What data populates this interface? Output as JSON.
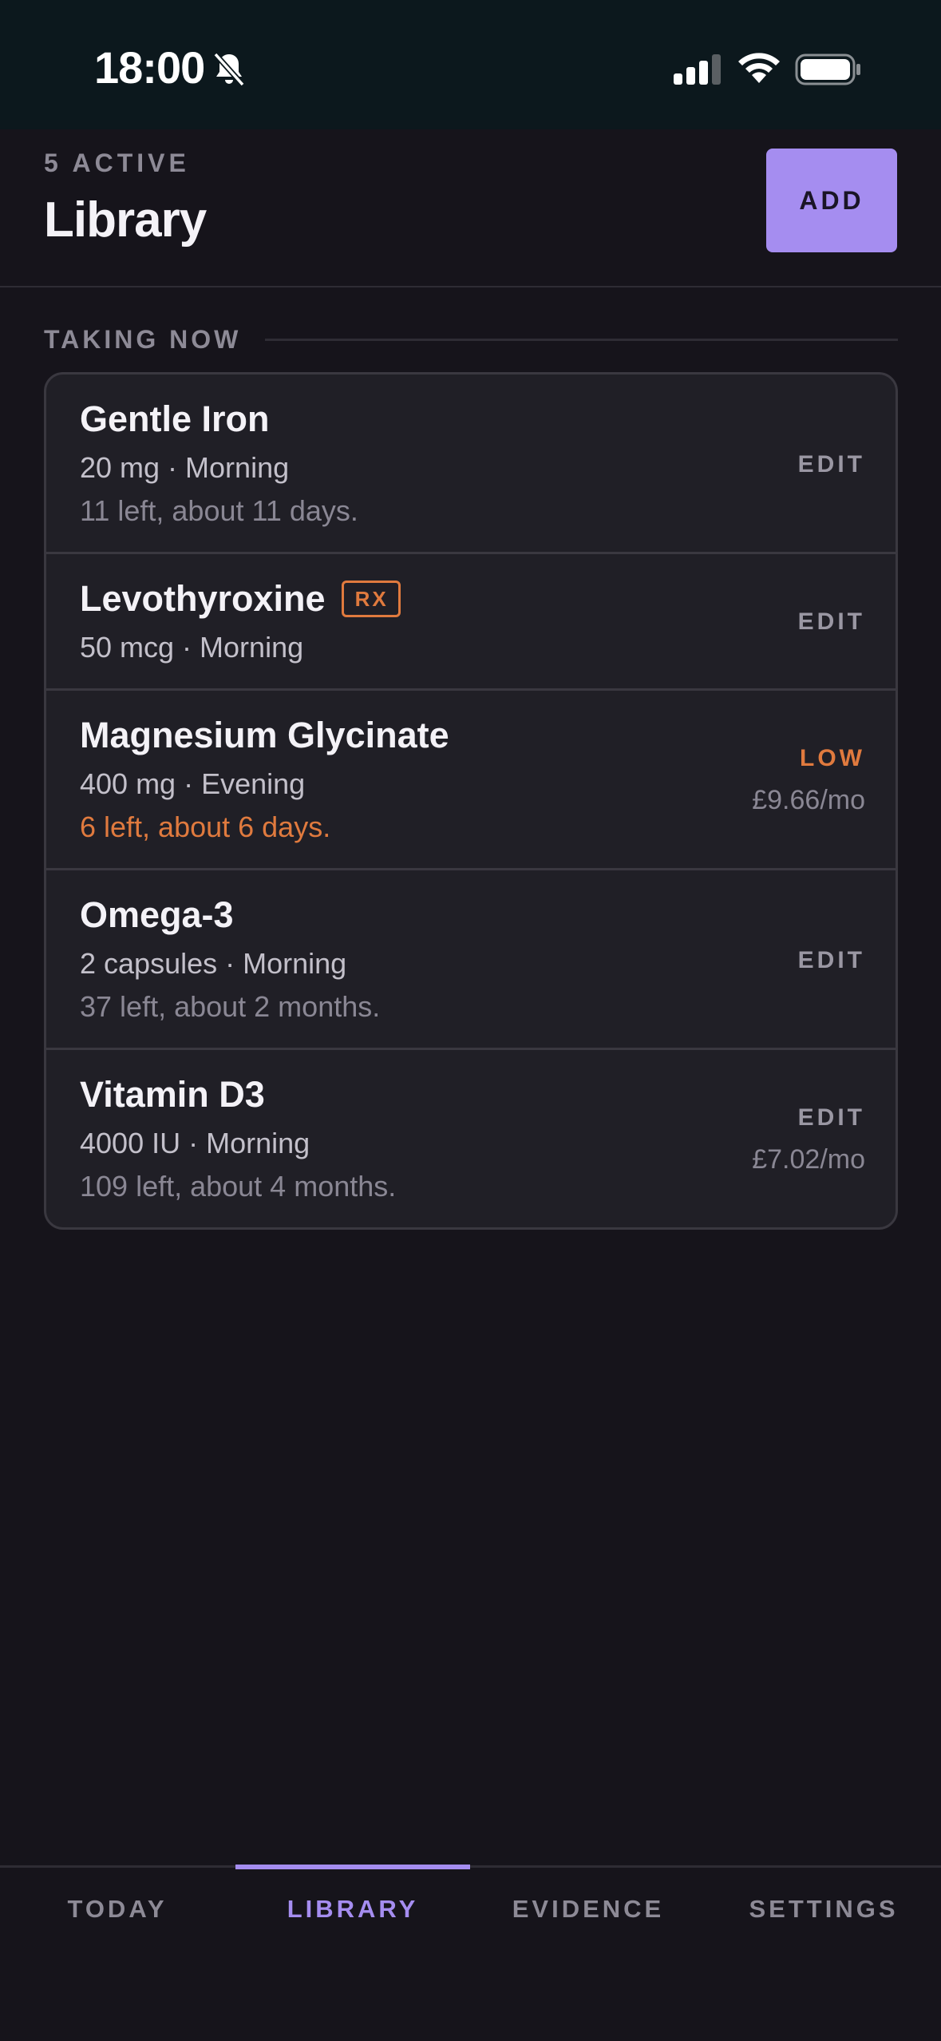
{
  "status_bar": {
    "time": "18:00",
    "icons": [
      "bell-slash-icon",
      "signal-icon",
      "wifi-icon",
      "battery-icon"
    ]
  },
  "header": {
    "active_count": "5 ACTIVE",
    "title": "Library",
    "add_label": "ADD"
  },
  "section": {
    "label": "TAKING NOW"
  },
  "medications": [
    {
      "name": "Gentle Iron",
      "dose": "20 mg · Morning",
      "supply": "11 left, about 11 days.",
      "action": "EDIT"
    },
    {
      "name": "Levothyroxine",
      "badge": "RX",
      "dose": "50 mcg · Morning",
      "action": "EDIT"
    },
    {
      "name": "Magnesium Glycinate",
      "dose": "400 mg · Evening",
      "supply": "6 left, about 6 days.",
      "action": "LOW",
      "price": "£9.66/mo"
    },
    {
      "name": "Omega-3",
      "dose": "2 capsules · Morning",
      "supply": "37 left, about 2 months.",
      "action": "EDIT"
    },
    {
      "name": "Vitamin D3",
      "dose": "4000 IU · Morning",
      "supply": "109 left, about 4 months.",
      "action": "EDIT",
      "price": "£7.02/mo"
    }
  ],
  "tabs": [
    {
      "label": "TODAY",
      "active": false
    },
    {
      "label": "LIBRARY",
      "active": true
    },
    {
      "label": "EVIDENCE",
      "active": false
    },
    {
      "label": "SETTINGS",
      "active": false
    }
  ],
  "colors": {
    "background": "#16141b",
    "accent": "#a58df0",
    "warning": "#e07a3e",
    "card": "#201f26"
  }
}
